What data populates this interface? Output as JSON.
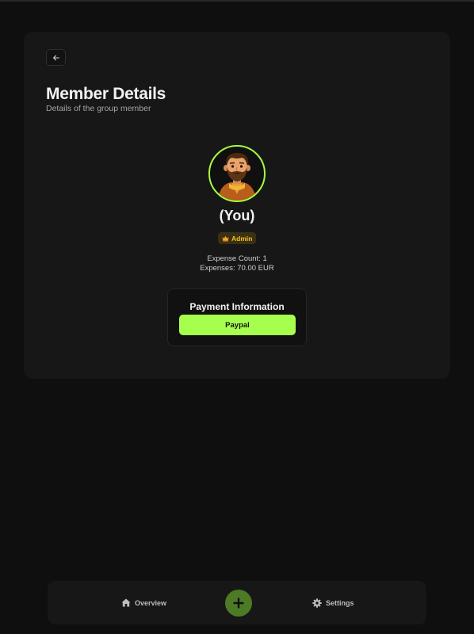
{
  "header": {
    "back_icon": "arrow-left-icon",
    "title": "Member Details",
    "subtitle": "Details of the group member"
  },
  "member": {
    "avatar_icon": "bearded-man-avatar",
    "name": "(You)",
    "role_icon": "crown-icon",
    "role": "Admin",
    "expense_count_label": "Expense Count: 1",
    "expenses_label": "Expenses: 70.00 EUR"
  },
  "payment": {
    "title": "Payment Information",
    "method": "Paypal"
  },
  "nav": {
    "overview_icon": "home-icon",
    "overview_label": "Overview",
    "add_icon": "plus-icon",
    "settings_icon": "gear-icon",
    "settings_label": "Settings"
  },
  "colors": {
    "accent": "#a6ff4d",
    "background": "#0f0f0f",
    "card": "#171717",
    "badge_text": "#f3c02c",
    "add_button": "#4d7a24"
  }
}
